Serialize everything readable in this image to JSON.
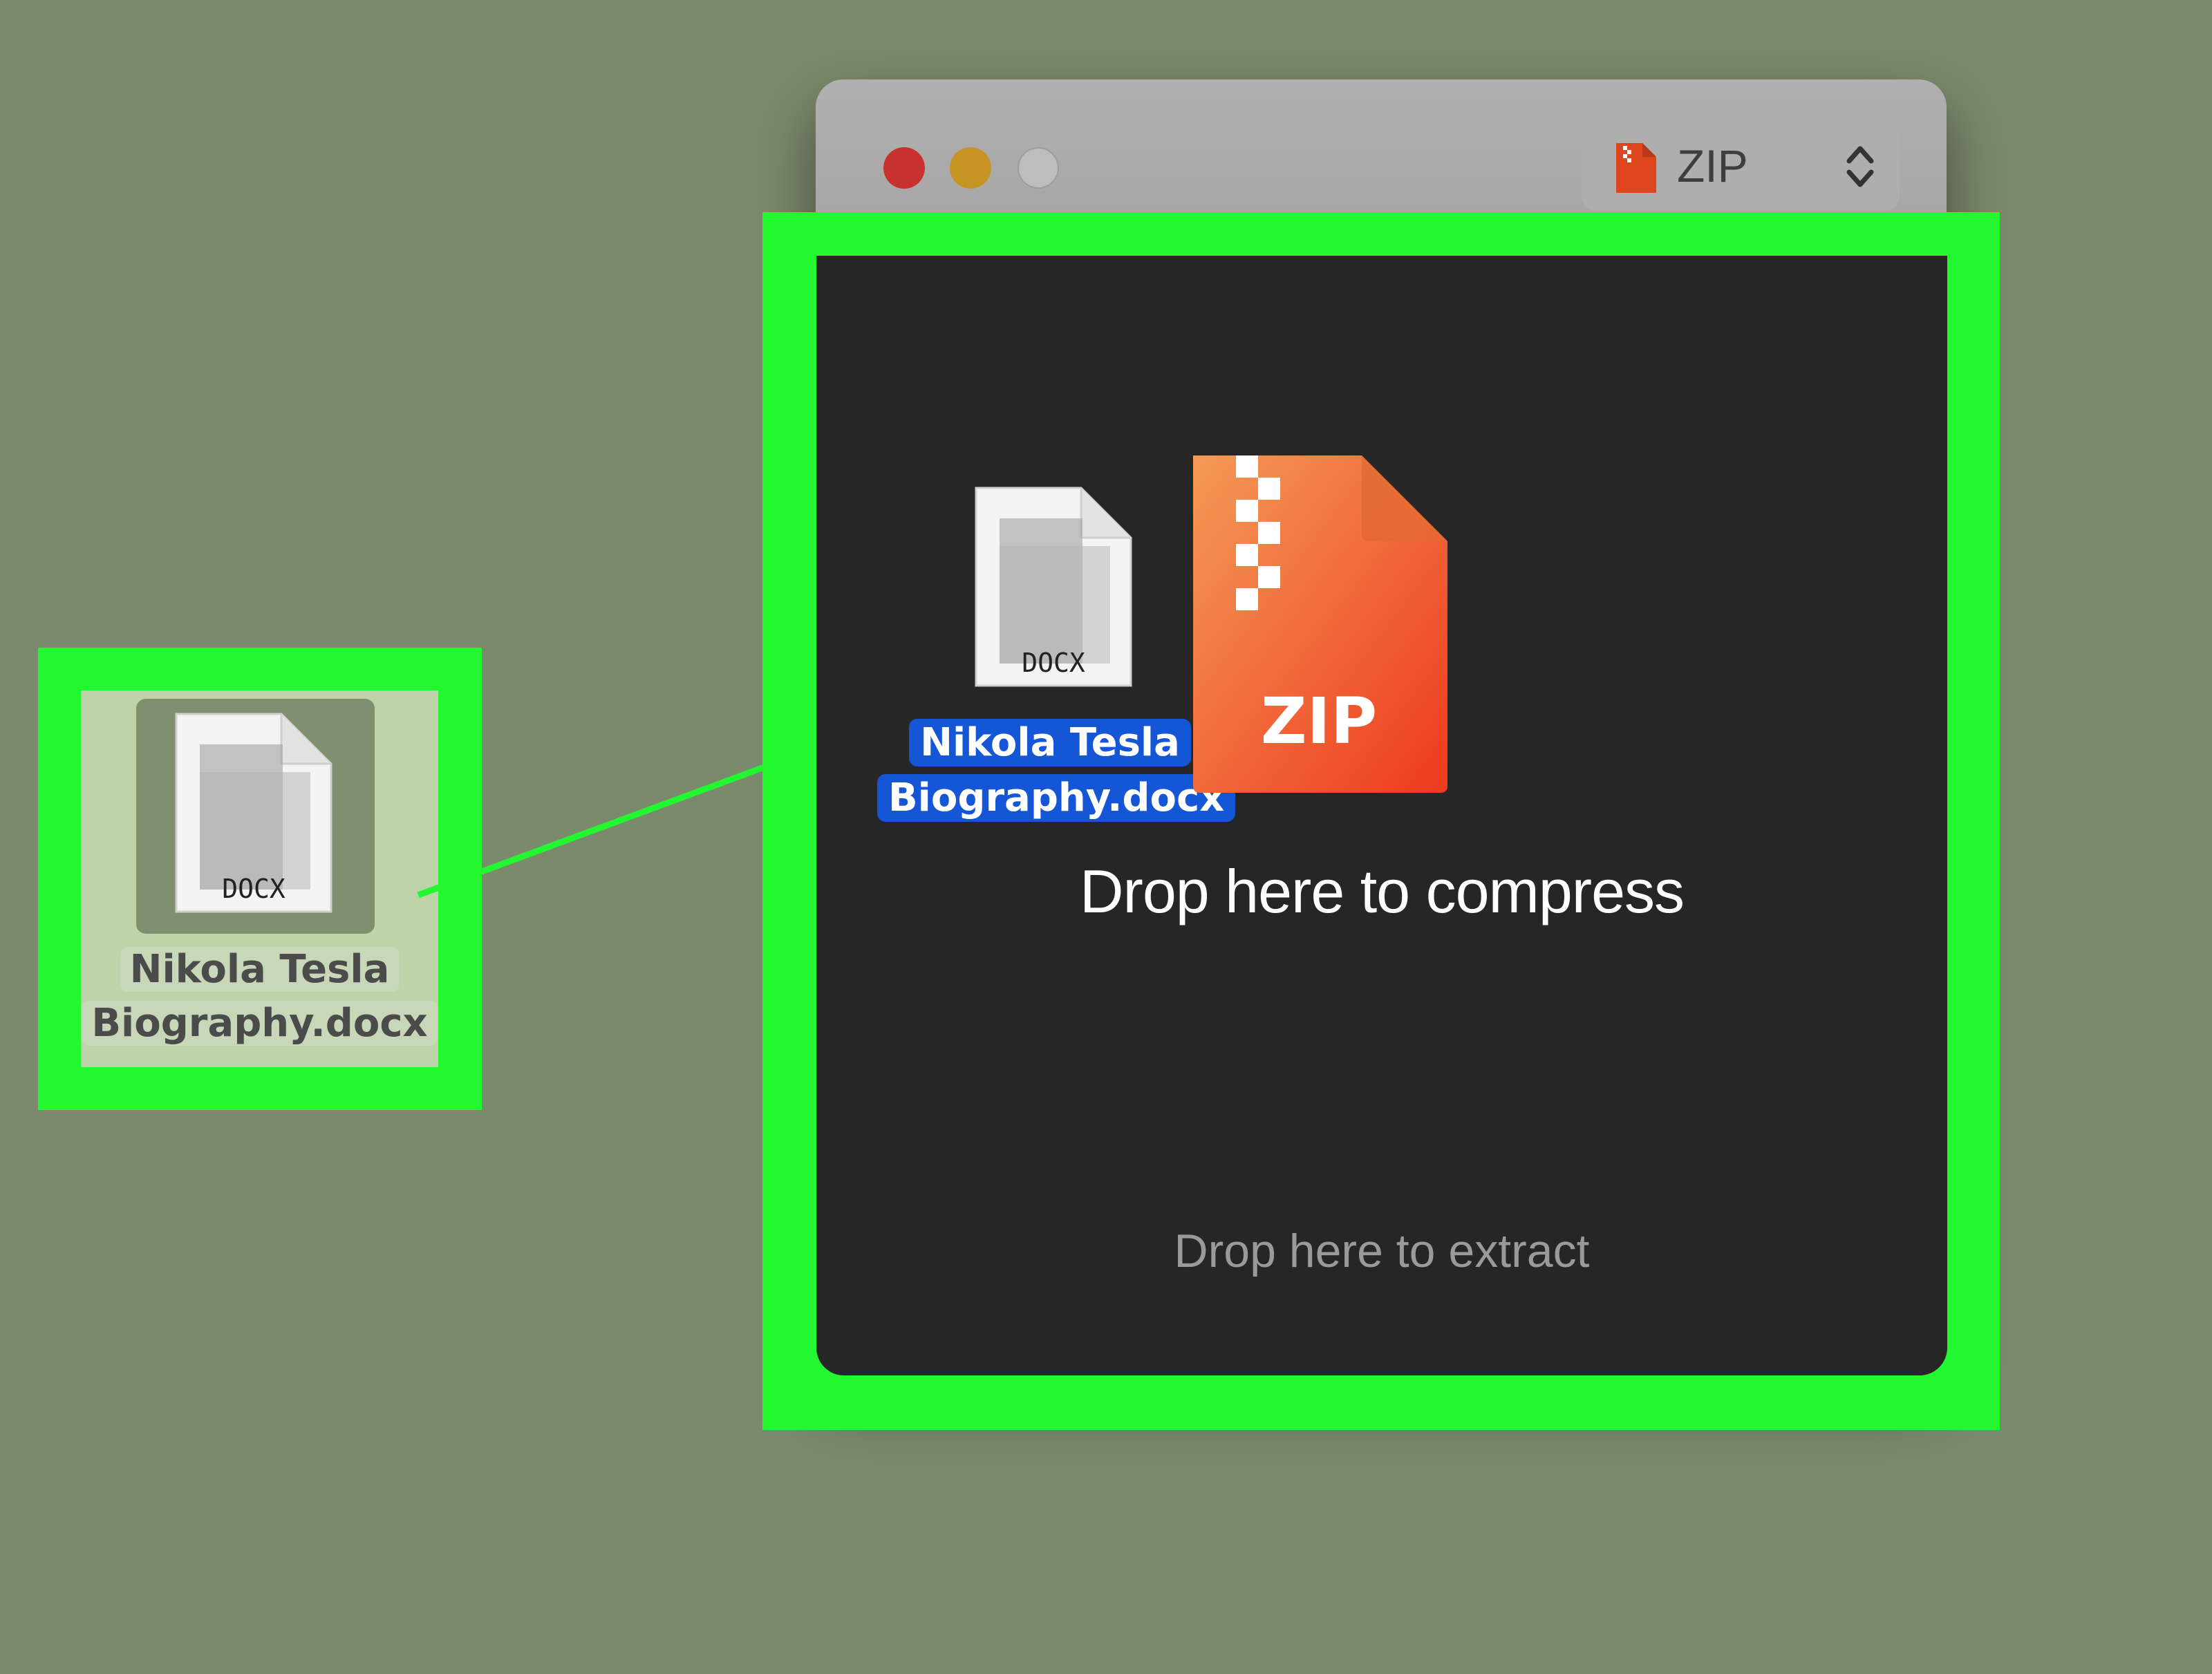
{
  "desktop": {
    "file": {
      "icon": "docx-file-icon",
      "badge": "DOCX",
      "name_line1": "Nikola Tesla",
      "name_line2": "Biography.docx"
    }
  },
  "window": {
    "format_selector": {
      "icon": "zip-file-icon",
      "value": "ZIP"
    },
    "dragged_file": {
      "icon": "docx-file-icon",
      "badge": "DOCX",
      "name_line1": "Nikola Tesla",
      "name_line2": "Biography.docx"
    },
    "archive_icon": {
      "icon": "zip-archive-icon",
      "label": "ZIP"
    },
    "compress_text": "Drop here to compress",
    "extract_text": "Drop here to extract"
  },
  "colors": {
    "highlight": "#22f730",
    "selection": "#1556d6",
    "zip_orange": "#f0582b"
  }
}
